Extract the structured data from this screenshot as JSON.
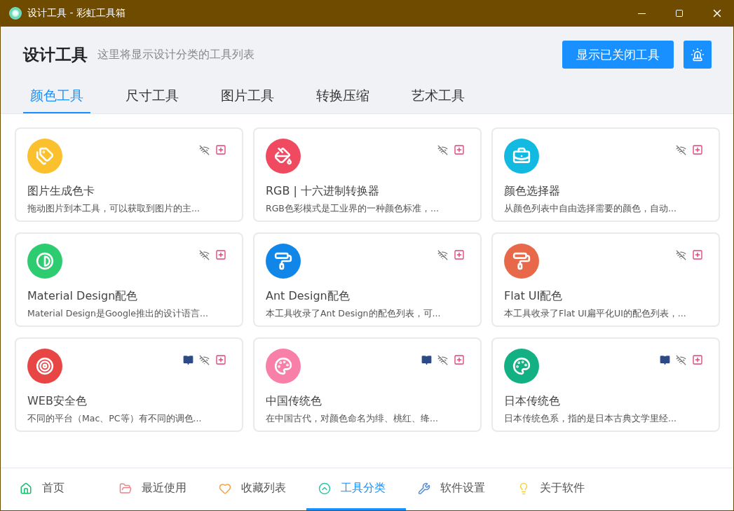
{
  "window": {
    "title": "设计工具 - 彩虹工具箱"
  },
  "header": {
    "title": "设计工具",
    "subtitle": "这里将显示设计分类的工具列表",
    "show_closed_button": "显示已关闭工具"
  },
  "tabs": [
    {
      "label": "颜色工具",
      "selected": true
    },
    {
      "label": "尺寸工具",
      "selected": false
    },
    {
      "label": "图片工具",
      "selected": false
    },
    {
      "label": "转换压缩",
      "selected": false
    },
    {
      "label": "艺术工具",
      "selected": false
    }
  ],
  "tools": [
    {
      "kind": "tags",
      "color": "#fbc02d",
      "title": "图片生成色卡",
      "description": "拖动图片到本工具，可以获取到图片的主...",
      "offline": true,
      "doc": false
    },
    {
      "kind": "bucket",
      "color": "#ef4a5f",
      "title": "RGB | 十六进制转换器",
      "description": "RGB色彩模式是工业界的一种颜色标准，...",
      "offline": true,
      "doc": false
    },
    {
      "kind": "toolbox",
      "color": "#12b9e0",
      "title": "颜色选择器",
      "description": "从颜色列表中自由选择需要的颜色，自动...",
      "offline": true,
      "doc": false
    },
    {
      "kind": "contrast",
      "color": "#2ecc71",
      "title": "Material Design配色",
      "description": "Material Design是Google推出的设计语言...",
      "offline": true,
      "doc": false
    },
    {
      "kind": "roller",
      "color": "#1086e8",
      "title": "Ant Design配色",
      "description": "本工具收录了Ant Design的配色列表，可...",
      "offline": true,
      "doc": false
    },
    {
      "kind": "roller",
      "color": "#e8694a",
      "title": "Flat UI配色",
      "description": "本工具收录了Flat UI扁平化UI的配色列表，...",
      "offline": true,
      "doc": false
    },
    {
      "kind": "target",
      "color": "#e84545",
      "title": "WEB安全色",
      "description": "不同的平台（Mac、PC等）有不同的调色...",
      "offline": true,
      "doc": true
    },
    {
      "kind": "palette",
      "color": "#f77fa8",
      "title": "中国传统色",
      "description": "在中国古代，对颜色命名为绯、桃红、绛...",
      "offline": true,
      "doc": true
    },
    {
      "kind": "palette",
      "color": "#13b083",
      "title": "日本传统色",
      "description": "日本传统色系，指的是日本古典文学里经...",
      "offline": true,
      "doc": true
    }
  ],
  "bottom_nav": [
    {
      "kind": "home",
      "color": "#19be6b",
      "label": "首页",
      "selected": false
    },
    {
      "kind": "folder",
      "color": "#f47f87",
      "label": "最近使用",
      "selected": false
    },
    {
      "kind": "heart",
      "color": "#f7a248",
      "label": "收藏列表",
      "selected": false
    },
    {
      "kind": "category",
      "color": "#2fc5a8",
      "label": "工具分类",
      "selected": true
    },
    {
      "kind": "wrench",
      "color": "#5a8fd8",
      "label": "软件设置",
      "selected": false
    },
    {
      "kind": "bulb",
      "color": "#f5d33b",
      "label": "关于软件",
      "selected": false
    }
  ]
}
